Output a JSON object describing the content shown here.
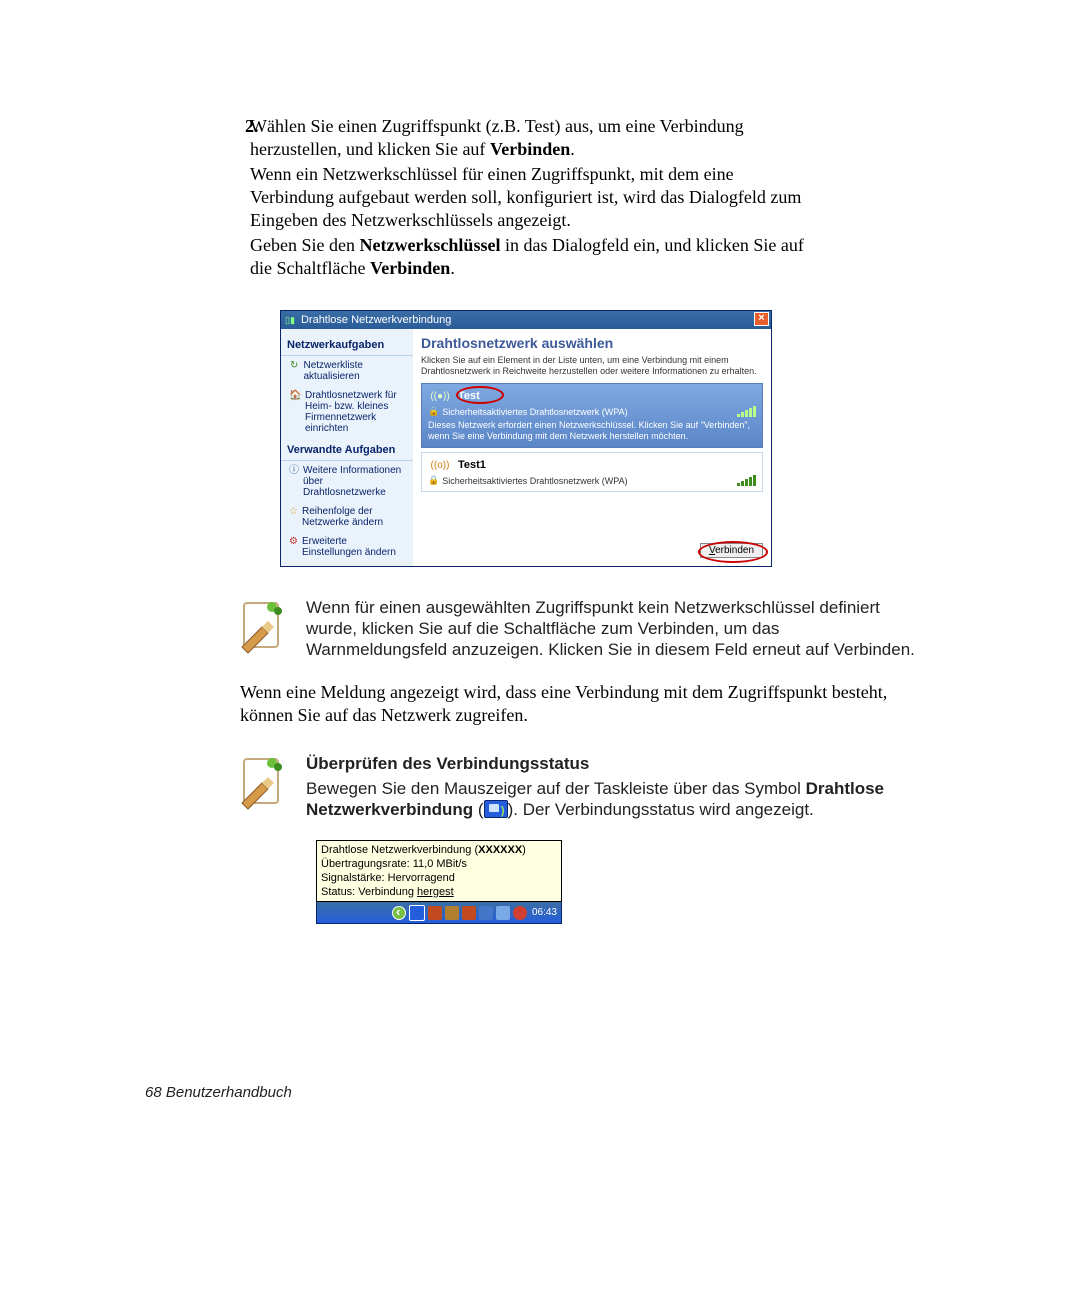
{
  "instruction": {
    "number": "2.",
    "p1a": "Wählen Sie einen Zugriffspunkt (z.B. Test) aus, um eine Verbindung herzustellen, und klicken Sie auf ",
    "p1b_bold": "Verbinden",
    "p1c": ".",
    "p2": "Wenn ein Netzwerkschlüssel für einen Zugriffspunkt, mit dem eine Verbindung aufgebaut werden soll, konfiguriert ist, wird das Dialogfeld zum Eingeben des Netzwerkschlüssels angezeigt.",
    "p3a": "Geben Sie den ",
    "p3b_bold": "Netzwerkschlüssel",
    "p3c": " in das Dialogfeld ein, und klicken Sie auf die Schaltfläche ",
    "p3d_bold": "Verbinden",
    "p3e": "."
  },
  "dialog": {
    "title": "Drahtlose Netzwerkverbindung",
    "sidebar": {
      "tasks_header": "Netzwerkaufgaben",
      "links": [
        {
          "icon": "↻",
          "label": "Netzwerkliste aktualisieren"
        },
        {
          "icon": "🏠",
          "label": "Drahtlosnetzwerk für Heim- bzw. kleines Firmennetzwerk einrichten"
        }
      ],
      "related_header": "Verwandte Aufgaben",
      "related_links": [
        {
          "icon": "ⓘ",
          "label": "Weitere Informationen über Drahtlosnetzwerke"
        },
        {
          "icon": "☆",
          "label": "Reihenfolge der Netzwerke ändern"
        },
        {
          "icon": "⚙",
          "label": "Erweiterte Einstellungen ändern"
        }
      ]
    },
    "main": {
      "heading": "Drahtlosnetzwerk auswählen",
      "instruction": "Klicken Sie auf ein Element in der Liste unten, um eine Verbindung mit einem Drahtlosnetzwerk in Reichweite herzustellen oder weitere Informationen zu erhalten.",
      "networks": [
        {
          "ssid": "Test",
          "ant": "((●))",
          "security": "Sicherheitsaktiviertes Drahtlosnetzwerk (WPA)",
          "desc": "Dieses Netzwerk erfordert einen Netzwerkschlüssel. Klicken Sie auf \"Verbinden\", wenn Sie eine Verbindung mit dem Netzwerk herstellen möchten.",
          "selected": true
        },
        {
          "ssid": "Test1",
          "ant": "((o))",
          "security": "Sicherheitsaktiviertes Drahtlosnetzwerk (WPA)",
          "selected": false
        }
      ],
      "button_label": "Verbinden"
    }
  },
  "note1": {
    "text": "Wenn für einen ausgewählten Zugriffspunkt kein Netzwerkschlüssel definiert wurde, klicken Sie auf die Schaltfläche zum Verbinden, um das Warnmeldungsfeld anzuzeigen. Klicken Sie in diesem Feld erneut auf Verbinden."
  },
  "plain_para": "Wenn eine Meldung angezeigt wird, dass eine Verbindung mit dem Zugriffspunkt besteht, können Sie auf das Netzwerk zugreifen.",
  "note2": {
    "heading": "Überprüfen des Verbindungsstatus",
    "p1a": "Bewegen Sie den Mauszeiger auf der Taskleiste über das Symbol ",
    "p1b_bold": "Drahtlose Netzwerkverbindung",
    "p1c": " (",
    "p1d": "). Der Verbindungsstatus wird angezeigt."
  },
  "tooltip": {
    "line1a": "Drahtlose Netzwerkverbindung (",
    "line1b_bold": "XXXXXX",
    "line1c": ")",
    "line2": "Übertragungsrate: 11,0 MBit/s",
    "line3": "Signalstärke: Hervorragend",
    "line4a": "Status: Verbindung ",
    "line4b_u": "hergest"
  },
  "taskbar": {
    "clock": "06:43"
  },
  "footer": "68  Benutzerhandbuch"
}
